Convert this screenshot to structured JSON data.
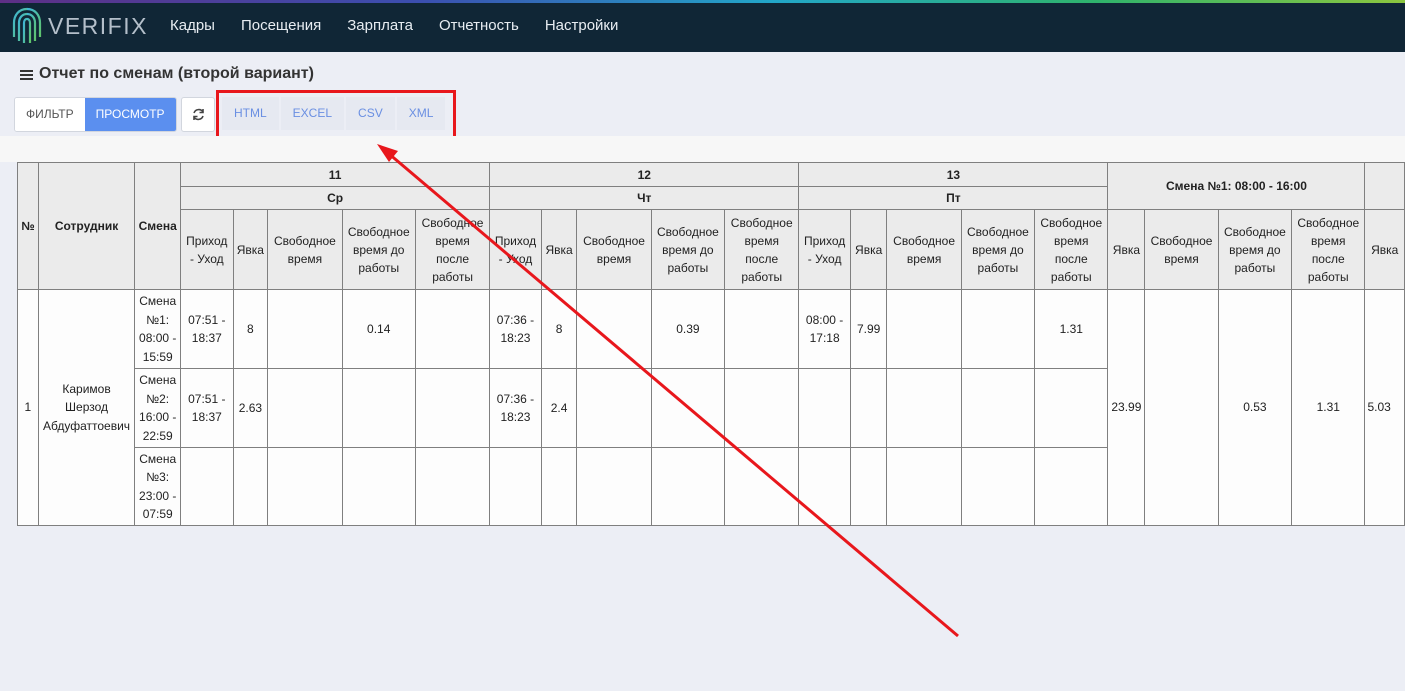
{
  "app": {
    "brand": "VERIFIX",
    "nav": [
      "Кадры",
      "Посещения",
      "Зарплата",
      "Отчетность",
      "Настройки"
    ]
  },
  "page": {
    "title": "Отчет по сменам (второй вариант)",
    "filter_button": "ФИЛЬТР",
    "view_button": "ПРОСМОТР",
    "exports": [
      "HTML",
      "EXCEL",
      "CSV",
      "XML"
    ]
  },
  "table": {
    "col_no": "№",
    "col_employee": "Сотрудник",
    "col_shift": "Смена",
    "days": [
      {
        "number": "11",
        "weekday": "Ср"
      },
      {
        "number": "12",
        "weekday": "Чт"
      },
      {
        "number": "13",
        "weekday": "Пт"
      }
    ],
    "day_subcols": [
      "Приход - Уход",
      "Явка",
      "Свободное время",
      "Свободное время до работы",
      "Свободное время после работы"
    ],
    "summary_header": "Смена №1: 08:00 - 16:00",
    "summary_subcols": [
      "Явка",
      "Свободное время",
      "Свободное время до работы",
      "Свободное время после работы"
    ],
    "next_subcol": "Явка",
    "row": {
      "no": "1",
      "employee": "Каримов Шерзод Абдуфаттоевич",
      "shifts": [
        {
          "name": "Смена №1: 08:00 - 15:59",
          "days": [
            [
              "07:51 - 18:37",
              "8",
              "",
              "0.14",
              ""
            ],
            [
              "07:36 - 18:23",
              "8",
              "",
              "0.39",
              ""
            ],
            [
              "08:00 - 17:18",
              "7.99",
              "",
              "",
              "1.31"
            ]
          ]
        },
        {
          "name": "Смена №2: 16:00 - 22:59",
          "days": [
            [
              "07:51 - 18:37",
              "2.63",
              "",
              "",
              ""
            ],
            [
              "07:36 - 18:23",
              "2.4",
              "",
              "",
              ""
            ],
            [
              "",
              "",
              "",
              "",
              ""
            ]
          ]
        },
        {
          "name": "Смена №3: 23:00 - 07:59",
          "days": [
            [
              "",
              "",
              "",
              "",
              ""
            ],
            [
              "",
              "",
              "",
              "",
              ""
            ],
            [
              "",
              "",
              "",
              "",
              ""
            ]
          ]
        }
      ],
      "summary": [
        "23.99",
        "",
        "0.53",
        "1.31"
      ],
      "next_value": "5.03"
    }
  },
  "colors": {
    "topbar": "#102636",
    "accent": "#5b8fef",
    "annotation": "#e8171c"
  }
}
